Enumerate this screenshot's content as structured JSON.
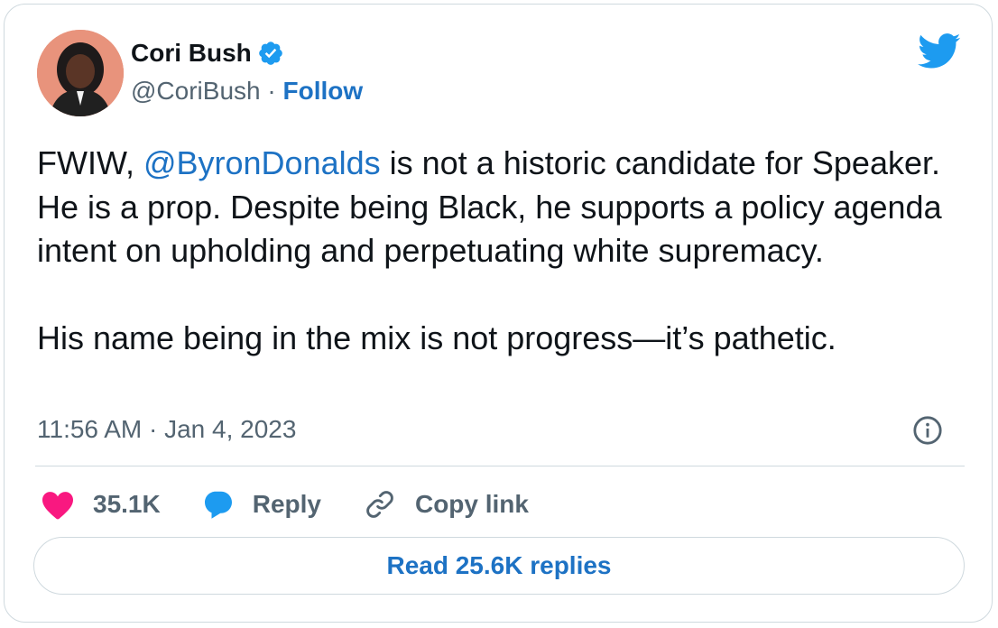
{
  "author": {
    "name": "Cori Bush",
    "handle": "@CoriBush",
    "separator": " · ",
    "follow_label": "Follow"
  },
  "tweet": {
    "text_before": "FWIW, ",
    "mention": "@ByronDonalds",
    "text_after": " is not a historic candidate for Speaker. He is a prop. Despite being Black, he supports a policy agenda intent on upholding and perpetuating white supremacy.\n\nHis name being in the mix is not progress—it’s pathetic.",
    "timestamp": "11:56 AM · Jan 4, 2023"
  },
  "actions": {
    "likes": "35.1K",
    "reply_label": "Reply",
    "copy_link_label": "Copy link",
    "read_replies_label": "Read 25.6K replies"
  },
  "colors": {
    "link": "#1d72c4",
    "twitter_blue": "#1d9bf0",
    "heart": "#f91880",
    "text": "#0f1419",
    "muted": "#536471"
  },
  "icons": [
    "verified-badge-icon",
    "twitter-bird-icon",
    "info-icon",
    "heart-icon",
    "reply-bubble-icon",
    "link-icon"
  ]
}
